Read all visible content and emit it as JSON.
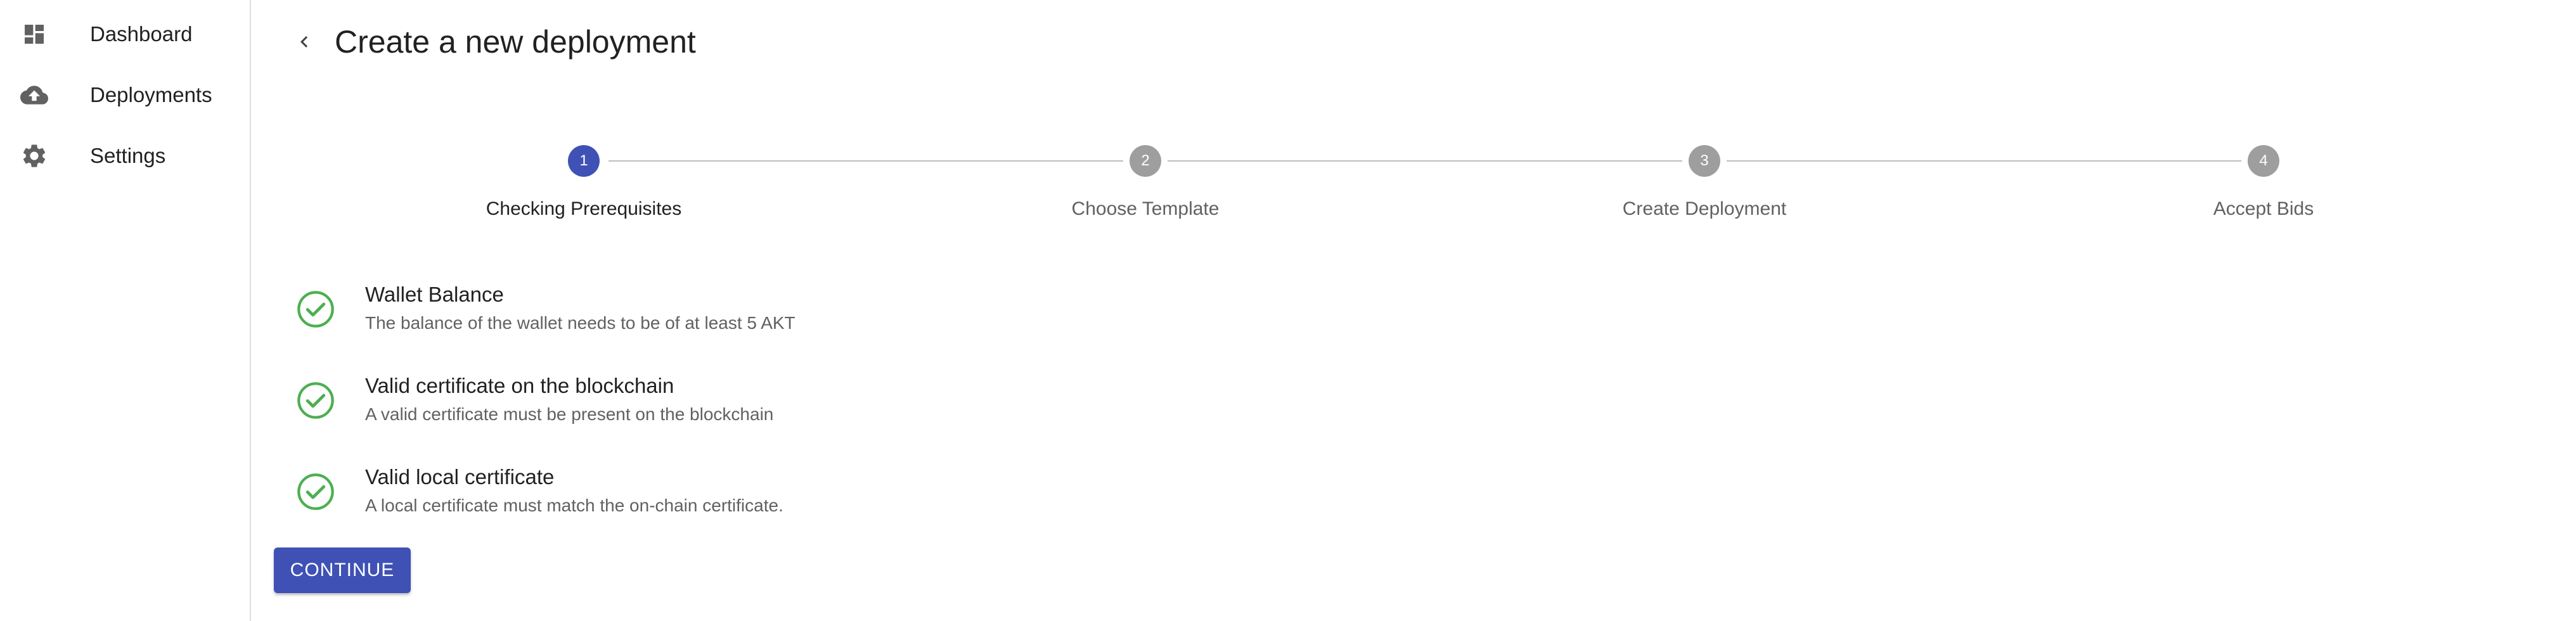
{
  "sidebar": {
    "items": [
      {
        "label": "Dashboard",
        "icon": "dashboard-icon"
      },
      {
        "label": "Deployments",
        "icon": "cloud-upload-icon"
      },
      {
        "label": "Settings",
        "icon": "gear-icon"
      }
    ]
  },
  "header": {
    "title": "Create a new deployment",
    "back_icon": "chevron-left-icon"
  },
  "stepper": {
    "active_step": 1,
    "steps": [
      {
        "number": "1",
        "label": "Checking Prerequisites"
      },
      {
        "number": "2",
        "label": "Choose Template"
      },
      {
        "number": "3",
        "label": "Create Deployment"
      },
      {
        "number": "4",
        "label": "Accept Bids"
      }
    ]
  },
  "checks": [
    {
      "title": "Wallet Balance",
      "description": "The balance of the wallet needs to be of at least 5 AKT",
      "status": "passed"
    },
    {
      "title": "Valid certificate on the blockchain",
      "description": "A valid certificate must be present on the blockchain",
      "status": "passed"
    },
    {
      "title": "Valid local certificate",
      "description": "A local certificate must match the on-chain certificate.",
      "status": "passed"
    }
  ],
  "actions": {
    "continue_label": "CONTINUE"
  },
  "colors": {
    "primary": "#3f51b5",
    "success": "#4caf50",
    "inactive_step": "#9e9e9e",
    "icon_gray": "#616161"
  }
}
